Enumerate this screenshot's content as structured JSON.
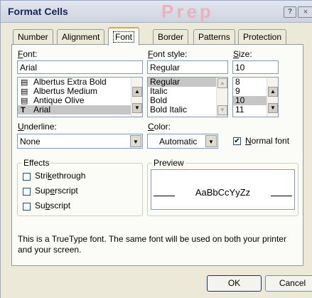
{
  "window": {
    "title": "Format Cells",
    "watermark": "Prep",
    "help_glyph": "?",
    "close_glyph": "×"
  },
  "tabs": [
    {
      "label": "Number"
    },
    {
      "label": "Alignment"
    },
    {
      "label": "Font",
      "active": true
    },
    {
      "label": "Border"
    },
    {
      "label": "Patterns"
    },
    {
      "label": "Protection"
    }
  ],
  "font": {
    "label_prefix": "F",
    "label_rest": "ont:",
    "value": "Arial",
    "list": [
      "Albertus Extra Bold",
      "Albertus Medium",
      "Antique Olive",
      "Arial"
    ],
    "list_icons": [
      "printer-font-icon",
      "printer-font-icon",
      "printer-font-icon",
      "truetype-icon"
    ],
    "selected": "Arial"
  },
  "font_style": {
    "label_prefix": "F",
    "label_mid": "o",
    "label_rest": "nt style:",
    "value": "Regular",
    "list": [
      "Regular",
      "Italic",
      "Bold",
      "Bold Italic"
    ],
    "selected": "Regular"
  },
  "size": {
    "label_prefix": "S",
    "label_rest": "ize:",
    "value": "10",
    "list": [
      "8",
      "9",
      "10",
      "11"
    ],
    "selected": "10"
  },
  "underline": {
    "label_prefix": "U",
    "label_rest": "nderline:",
    "value": "None"
  },
  "color": {
    "label_prefix": "C",
    "label_rest": "olor:",
    "value": "Automatic"
  },
  "normal_font": {
    "checked": true,
    "label_prefix": "N",
    "label_rest": "ormal font"
  },
  "effects": {
    "title": "Effects",
    "items": [
      {
        "before": "Stri",
        "u": "k",
        "after": "ethrough",
        "checked": false
      },
      {
        "before": "Sup",
        "u": "e",
        "after": "rscript",
        "checked": false
      },
      {
        "before": "Su",
        "u": "b",
        "after": "script",
        "checked": false
      }
    ]
  },
  "preview": {
    "title": "Preview",
    "sample": "AaBbCcYyZz"
  },
  "info_text": "This is a TrueType font.  The same font will be used on both your printer and your screen.",
  "buttons": {
    "ok": "OK",
    "cancel": "Cancel"
  },
  "icons": {
    "check": "✔",
    "up": "▲",
    "down": "▼",
    "truetype": "T",
    "printer": "▤"
  }
}
